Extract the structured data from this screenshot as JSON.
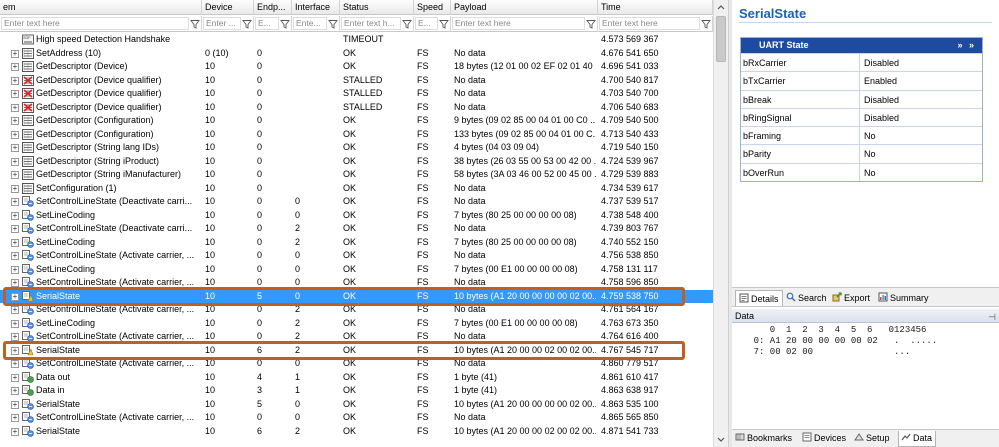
{
  "table": {
    "columns": [
      {
        "label": "em",
        "filter": "Enter text here"
      },
      {
        "label": "Device",
        "filter": "Enter ..."
      },
      {
        "label": "Endp...",
        "filter": "E..."
      },
      {
        "label": "Interface",
        "filter": "Ente..."
      },
      {
        "label": "Status",
        "filter": "Enter text h..."
      },
      {
        "label": "Speed",
        "filter": "E..."
      },
      {
        "label": "Payload",
        "filter": "Enter text here"
      },
      {
        "label": "Time",
        "filter": "Enter text here"
      }
    ],
    "rows": [
      {
        "icon": "sof",
        "expand": false,
        "item": "High speed Detection Handshake",
        "device": "",
        "endpoint": "",
        "interface": "",
        "status": "TIMEOUT",
        "speed": "",
        "payload": "",
        "time": "4.573 569 367"
      },
      {
        "icon": "setup",
        "expand": true,
        "item": "SetAddress (10)",
        "device": "0 (10)",
        "endpoint": "0",
        "interface": "",
        "status": "OK",
        "speed": "FS",
        "payload": "No data",
        "time": "4.676 541 650"
      },
      {
        "icon": "setup",
        "expand": true,
        "item": "GetDescriptor (Device)",
        "device": "10",
        "endpoint": "0",
        "interface": "",
        "status": "OK",
        "speed": "FS",
        "payload": "18 bytes (12 01 00 02 EF 02 01 40 ...",
        "time": "4.696 541 033"
      },
      {
        "icon": "error",
        "expand": true,
        "item": "GetDescriptor (Device qualifier)",
        "device": "10",
        "endpoint": "0",
        "interface": "",
        "status": "STALLED",
        "speed": "FS",
        "payload": "No data",
        "time": "4.700 540 817"
      },
      {
        "icon": "error",
        "expand": true,
        "item": "GetDescriptor (Device qualifier)",
        "device": "10",
        "endpoint": "0",
        "interface": "",
        "status": "STALLED",
        "speed": "FS",
        "payload": "No data",
        "time": "4.703 540 700"
      },
      {
        "icon": "error",
        "expand": true,
        "item": "GetDescriptor (Device qualifier)",
        "device": "10",
        "endpoint": "0",
        "interface": "",
        "status": "STALLED",
        "speed": "FS",
        "payload": "No data",
        "time": "4.706 540 683"
      },
      {
        "icon": "setup",
        "expand": true,
        "item": "GetDescriptor (Configuration)",
        "device": "10",
        "endpoint": "0",
        "interface": "",
        "status": "OK",
        "speed": "FS",
        "payload": "9 bytes (09 02 85 00 04 01 00 C0 ...",
        "time": "4.709 540 500"
      },
      {
        "icon": "setup",
        "expand": true,
        "item": "GetDescriptor (Configuration)",
        "device": "10",
        "endpoint": "0",
        "interface": "",
        "status": "OK",
        "speed": "FS",
        "payload": "133 bytes (09 02 85 00 04 01 00 C...",
        "time": "4.713 540 433"
      },
      {
        "icon": "setup",
        "expand": true,
        "item": "GetDescriptor (String lang IDs)",
        "device": "10",
        "endpoint": "0",
        "interface": "",
        "status": "OK",
        "speed": "FS",
        "payload": "4 bytes (04 03 09 04)",
        "time": "4.719 540 150"
      },
      {
        "icon": "setup",
        "expand": true,
        "item": "GetDescriptor (String iProduct)",
        "device": "10",
        "endpoint": "0",
        "interface": "",
        "status": "OK",
        "speed": "FS",
        "payload": "38 bytes (26 03 55 00 53 00 42 00 ...",
        "time": "4.724 539 967"
      },
      {
        "icon": "setup",
        "expand": true,
        "item": "GetDescriptor (String iManufacturer)",
        "device": "10",
        "endpoint": "0",
        "interface": "",
        "status": "OK",
        "speed": "FS",
        "payload": "58 bytes (3A 03 46 00 52 00 45 00 ...",
        "time": "4.729 539 883"
      },
      {
        "icon": "setup",
        "expand": true,
        "item": "SetConfiguration (1)",
        "device": "10",
        "endpoint": "0",
        "interface": "",
        "status": "OK",
        "speed": "FS",
        "payload": "No data",
        "time": "4.734 539 617"
      },
      {
        "icon": "class",
        "expand": true,
        "item": "SetControlLineState (Deactivate carri...",
        "device": "10",
        "endpoint": "0",
        "interface": "0",
        "status": "OK",
        "speed": "FS",
        "payload": "No data",
        "time": "4.737 539 517"
      },
      {
        "icon": "class",
        "expand": true,
        "item": "SetLineCoding",
        "device": "10",
        "endpoint": "0",
        "interface": "0",
        "status": "OK",
        "speed": "FS",
        "payload": "7 bytes (80 25 00 00 00 00 08)",
        "time": "4.738 548 400"
      },
      {
        "icon": "class",
        "expand": true,
        "item": "SetControlLineState (Deactivate carri...",
        "device": "10",
        "endpoint": "0",
        "interface": "2",
        "status": "OK",
        "speed": "FS",
        "payload": "No data",
        "time": "4.739 803 767"
      },
      {
        "icon": "class",
        "expand": true,
        "item": "SetLineCoding",
        "device": "10",
        "endpoint": "0",
        "interface": "2",
        "status": "OK",
        "speed": "FS",
        "payload": "7 bytes (80 25 00 00 00 00 08)",
        "time": "4.740 552 150"
      },
      {
        "icon": "class",
        "expand": true,
        "item": "SetControlLineState (Activate carrier, ...",
        "device": "10",
        "endpoint": "0",
        "interface": "0",
        "status": "OK",
        "speed": "FS",
        "payload": "No data",
        "time": "4.756 538 850"
      },
      {
        "icon": "class",
        "expand": true,
        "item": "SetLineCoding",
        "device": "10",
        "endpoint": "0",
        "interface": "0",
        "status": "OK",
        "speed": "FS",
        "payload": "7 bytes (00 E1 00 00 00 00 08)",
        "time": "4.758 131 117"
      },
      {
        "icon": "class",
        "expand": true,
        "item": "SetControlLineState (Activate carrier, ...",
        "device": "10",
        "endpoint": "0",
        "interface": "0",
        "status": "OK",
        "speed": "FS",
        "payload": "No data",
        "time": "4.758 596 850"
      },
      {
        "icon": "serial",
        "expand": true,
        "item": "SerialState",
        "device": "10",
        "endpoint": "5",
        "interface": "0",
        "status": "OK",
        "speed": "FS",
        "payload": "10 bytes (A1 20 00 00 00 00 02 00...",
        "time": "4.759 538 750",
        "selected": true
      },
      {
        "icon": "class",
        "expand": true,
        "item": "SetControlLineState (Activate carrier, ...",
        "device": "10",
        "endpoint": "0",
        "interface": "2",
        "status": "OK",
        "speed": "FS",
        "payload": "No data",
        "time": "4.761 564 167"
      },
      {
        "icon": "class",
        "expand": true,
        "item": "SetLineCoding",
        "device": "10",
        "endpoint": "0",
        "interface": "2",
        "status": "OK",
        "speed": "FS",
        "payload": "7 bytes (00 E1 00 00 00 00 08)",
        "time": "4.763 673 350"
      },
      {
        "icon": "class",
        "expand": true,
        "item": "SetControlLineState (Activate carrier, ...",
        "device": "10",
        "endpoint": "0",
        "interface": "2",
        "status": "OK",
        "speed": "FS",
        "payload": "No data",
        "time": "4.764 616 400"
      },
      {
        "icon": "serial",
        "expand": true,
        "item": "SerialState",
        "device": "10",
        "endpoint": "6",
        "interface": "2",
        "status": "OK",
        "speed": "FS",
        "payload": "10 bytes (A1 20 00 00 02 00 02 00...",
        "time": "4.767 545 717",
        "highlight": true
      },
      {
        "icon": "class",
        "expand": true,
        "item": "SetControlLineState (Activate carrier, ...",
        "device": "10",
        "endpoint": "0",
        "interface": "0",
        "status": "OK",
        "speed": "FS",
        "payload": "No data",
        "time": "4.860 779 517"
      },
      {
        "icon": "data",
        "expand": true,
        "item": "Data out",
        "device": "10",
        "endpoint": "4",
        "interface": "1",
        "status": "OK",
        "speed": "FS",
        "payload": "1 byte (41)",
        "time": "4.861 610 417"
      },
      {
        "icon": "data",
        "expand": true,
        "item": "Data in",
        "device": "10",
        "endpoint": "3",
        "interface": "1",
        "status": "OK",
        "speed": "FS",
        "payload": "1 byte (41)",
        "time": "4.863 638 917"
      },
      {
        "icon": "class",
        "expand": true,
        "item": "SerialState",
        "device": "10",
        "endpoint": "5",
        "interface": "0",
        "status": "OK",
        "speed": "FS",
        "payload": "10 bytes (A1 20 00 00 00 00 02 00...",
        "time": "4.863 535 100"
      },
      {
        "icon": "class",
        "expand": true,
        "item": "SetControlLineState (Activate carrier, ...",
        "device": "10",
        "endpoint": "0",
        "interface": "0",
        "status": "OK",
        "speed": "FS",
        "payload": "No data",
        "time": "4.865 565 850"
      },
      {
        "icon": "class",
        "expand": true,
        "item": "SerialState",
        "device": "10",
        "endpoint": "6",
        "interface": "2",
        "status": "OK",
        "speed": "FS",
        "payload": "10 bytes (A1 20 00 00 02 00 02 00...",
        "time": "4.871 541 733"
      }
    ]
  },
  "details": {
    "title": "SerialState",
    "uart": {
      "header": "UART State",
      "chevrons": "» »",
      "fields": [
        {
          "key": "bRxCarrier",
          "value": "Disabled"
        },
        {
          "key": "bTxCarrier",
          "value": "Enabled"
        },
        {
          "key": "bBreak",
          "value": "Disabled"
        },
        {
          "key": "bRingSignal",
          "value": "Disabled"
        },
        {
          "key": "bFraming",
          "value": "No"
        },
        {
          "key": "bParity",
          "value": "No"
        },
        {
          "key": "bOverRun",
          "value": "No"
        }
      ]
    },
    "tabs": [
      "Details",
      "Search",
      "Export",
      "Summary"
    ]
  },
  "data_pane": {
    "title": "Data",
    "header_line": "       0  1  2  3  4  5  6   0123456",
    "lines": [
      "    0: A1 20 00 00 00 00 02   .  .....",
      "    7: 00 02 00               ..."
    ]
  },
  "bottom_tabs": [
    "Bookmarks",
    "Devices",
    "Setup",
    "Data"
  ],
  "colors": {
    "selection": "#3399ff",
    "highlight_border": "#c0601c",
    "uart_header": "#1e4aa0",
    "title_blue": "#1f5fb4"
  }
}
